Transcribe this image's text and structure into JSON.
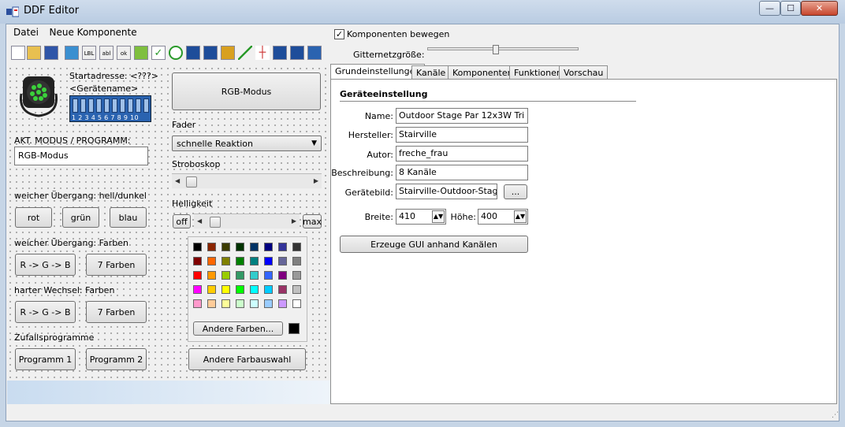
{
  "window": {
    "title": "DDF Editor",
    "minimize_glyph": "—",
    "maximize_glyph": "☐",
    "close_glyph": "✕"
  },
  "menu": {
    "file": "Datei",
    "new_component": "Neue Komponente"
  },
  "options": {
    "move_components_label": "Komponenten bewegen",
    "move_components_checked": true,
    "grid_size_label": "Gitternetzgröße:",
    "grid_size_value": 0.45
  },
  "toolbar": {
    "items": [
      {
        "icon": "new-file-icon",
        "glyph": ""
      },
      {
        "icon": "open-folder-icon",
        "glyph": ""
      },
      {
        "icon": "save-icon",
        "glyph": ""
      },
      {
        "icon": "image-icon",
        "glyph": ""
      },
      {
        "icon": "label-icon",
        "glyph": "LBL"
      },
      {
        "icon": "textbox-icon",
        "glyph": "abl"
      },
      {
        "icon": "button-icon",
        "glyph": "ok"
      },
      {
        "icon": "progress-icon",
        "glyph": ""
      },
      {
        "icon": "checkbox-icon",
        "glyph": "✓"
      },
      {
        "icon": "radio-icon",
        "glyph": ""
      },
      {
        "icon": "combobox-icon",
        "glyph": ""
      },
      {
        "icon": "numeric-icon",
        "glyph": ""
      },
      {
        "icon": "color-grid-icon",
        "glyph": ""
      },
      {
        "icon": "line-icon",
        "glyph": ""
      },
      {
        "icon": "crosshair-icon",
        "glyph": ""
      },
      {
        "icon": "listbox-icon",
        "glyph": ""
      },
      {
        "icon": "listbox2-icon",
        "glyph": ""
      },
      {
        "icon": "dmx-switch-icon",
        "glyph": ""
      }
    ]
  },
  "designer": {
    "start_address": "Startadresse: <???>",
    "device_name": "<Gerätename>",
    "dip_labels": "1 2 3 4 5 6 7 8 9 10",
    "dip_on": "O",
    "current_mode_label": "AKT. MODUS / PROGRAMM:",
    "current_mode_value": "RGB-Modus",
    "rgb_mode_button": "RGB-Modus",
    "fader_label": "Fader",
    "fader_select": "schnelle Reaktion",
    "strobe_label": "Stroboskop",
    "brightness_label": "Helligkeit",
    "off_button": "off",
    "max_button": "max",
    "soft_hd_label": "weicher Übergang: hell/dunkel",
    "red_button": "rot",
    "green_button": "grün",
    "blue_button": "blau",
    "soft_colors_label": "weicher Übergang: Farben",
    "rgb_cycle_button": "R -> G -> B",
    "seven_colors_button": "7 Farben",
    "hard_colors_label": "harter Wechsel: Farben",
    "rgb_cycle_button2": "R -> G -> B",
    "seven_colors_button2": "7 Farben",
    "random_label": "Zufallsprogramme",
    "program1_button": "Programm 1",
    "program2_button": "Programm 2",
    "other_colors_button": "Andere Farben...",
    "other_color_select_button": "Andere Farbauswahl",
    "palette": [
      [
        "#000000",
        "#8b2500",
        "#3b3b00",
        "#003300",
        "#003366",
        "#000080",
        "#333399",
        "#333333"
      ],
      [
        "#800000",
        "#ff6600",
        "#808000",
        "#008000",
        "#008080",
        "#0000ff",
        "#666699",
        "#808080"
      ],
      [
        "#ff0000",
        "#ff9900",
        "#99cc00",
        "#339966",
        "#33cccc",
        "#3366ff",
        "#800080",
        "#999999"
      ],
      [
        "#ff00ff",
        "#ffcc00",
        "#ffff00",
        "#00ff00",
        "#00ffff",
        "#00ccff",
        "#993366",
        "#c0c0c0"
      ],
      [
        "#ff99cc",
        "#ffcc99",
        "#ffff99",
        "#ccffcc",
        "#ccffff",
        "#99ccff",
        "#cc99ff",
        "#ffffff"
      ]
    ],
    "selected_color": "#000000"
  },
  "tabs": [
    {
      "label": "Grundeinstellungen",
      "active": true
    },
    {
      "label": "Kanäle"
    },
    {
      "label": "Komponenten"
    },
    {
      "label": "Funktionen"
    },
    {
      "label": "Vorschau"
    }
  ],
  "settings": {
    "heading": "Geräteeinstellung",
    "name_label": "Name:",
    "name_value": "Outdoor Stage Par 12x3W Tri",
    "manufacturer_label": "Hersteller:",
    "manufacturer_value": "Stairville",
    "author_label": "Autor:",
    "author_value": "freche_frau",
    "description_label": "Beschreibung:",
    "description_value": "8 Kanäle",
    "image_label": "Gerätebild:",
    "image_value": "Stairville-Outdoor-Stage-P...",
    "browse_button": "...",
    "width_label": "Breite:",
    "width_value": "410",
    "height_label": "Höhe:",
    "height_value": "400",
    "generate_button": "Erzeuge GUI anhand Kanälen"
  }
}
